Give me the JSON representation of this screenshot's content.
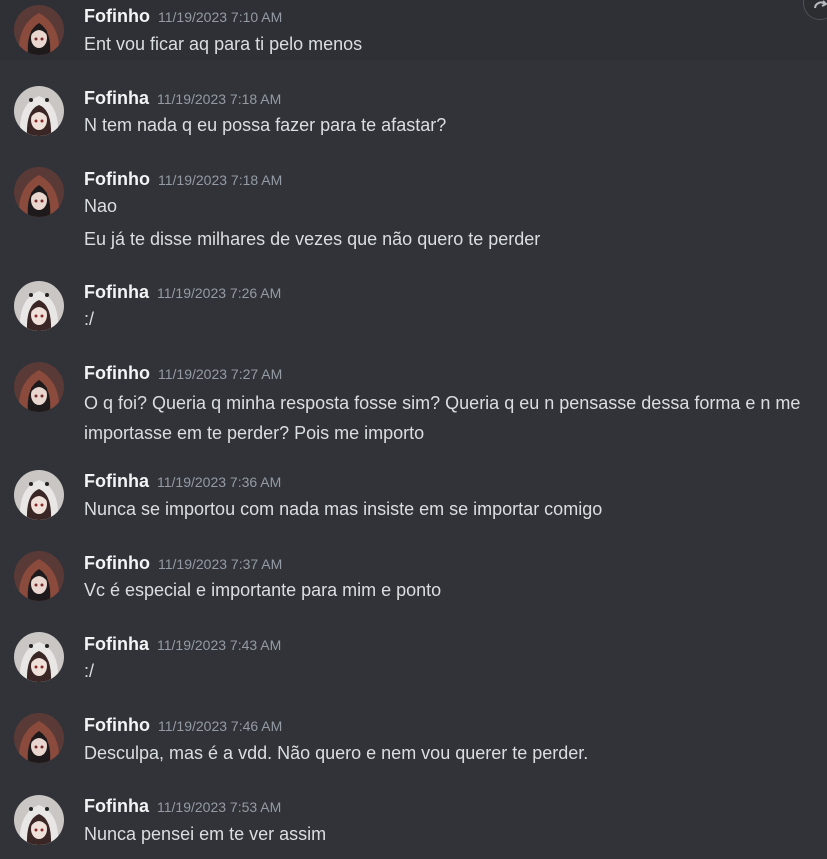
{
  "messages": [
    {
      "author": "Fofinho",
      "timestamp": "11/19/2023 7:10 AM",
      "avatar": "fofinho",
      "lines": [
        "Ent vou ficar aq para ti pelo menos"
      ]
    },
    {
      "author": "Fofinha",
      "timestamp": "11/19/2023 7:18 AM",
      "avatar": "fofinha",
      "lines": [
        "N tem nada q eu possa fazer para te afastar?"
      ]
    },
    {
      "author": "Fofinho",
      "timestamp": "11/19/2023 7:18 AM",
      "avatar": "fofinho",
      "lines": [
        "Nao",
        "Eu já te disse milhares de vezes que não quero te perder"
      ]
    },
    {
      "author": "Fofinha",
      "timestamp": "11/19/2023 7:26 AM",
      "avatar": "fofinha",
      "lines": [
        ":/"
      ]
    },
    {
      "author": "Fofinho",
      "timestamp": "11/19/2023 7:27 AM",
      "avatar": "fofinho",
      "lines": [
        "O q foi? Queria q minha resposta fosse sim? Queria q eu n pensasse dessa forma e n me importasse em te perder? Pois me importo"
      ]
    },
    {
      "author": "Fofinha",
      "timestamp": "11/19/2023 7:36 AM",
      "avatar": "fofinha",
      "lines": [
        "Nunca se importou com nada mas insiste em se importar comigo"
      ]
    },
    {
      "author": "Fofinho",
      "timestamp": "11/19/2023 7:37 AM",
      "avatar": "fofinho",
      "lines": [
        "Vc é especial e importante para mim e ponto"
      ]
    },
    {
      "author": "Fofinha",
      "timestamp": "11/19/2023 7:43 AM",
      "avatar": "fofinha",
      "lines": [
        ":/"
      ]
    },
    {
      "author": "Fofinho",
      "timestamp": "11/19/2023 7:46 AM",
      "avatar": "fofinho",
      "lines": [
        "Desculpa, mas é a vdd. Não quero e nem vou querer te perder."
      ]
    },
    {
      "author": "Fofinha",
      "timestamp": "11/19/2023 7:53 AM",
      "avatar": "fofinha",
      "lines": [
        "Nunca pensei em te ver assim"
      ]
    }
  ],
  "colors": {
    "background": "#313338",
    "hover_background": "#2e3035",
    "username": "#f2f3f5",
    "timestamp": "#949ba4",
    "message_text": "#dbdee1"
  },
  "icons": {
    "scroll_button": "refresh-icon"
  }
}
